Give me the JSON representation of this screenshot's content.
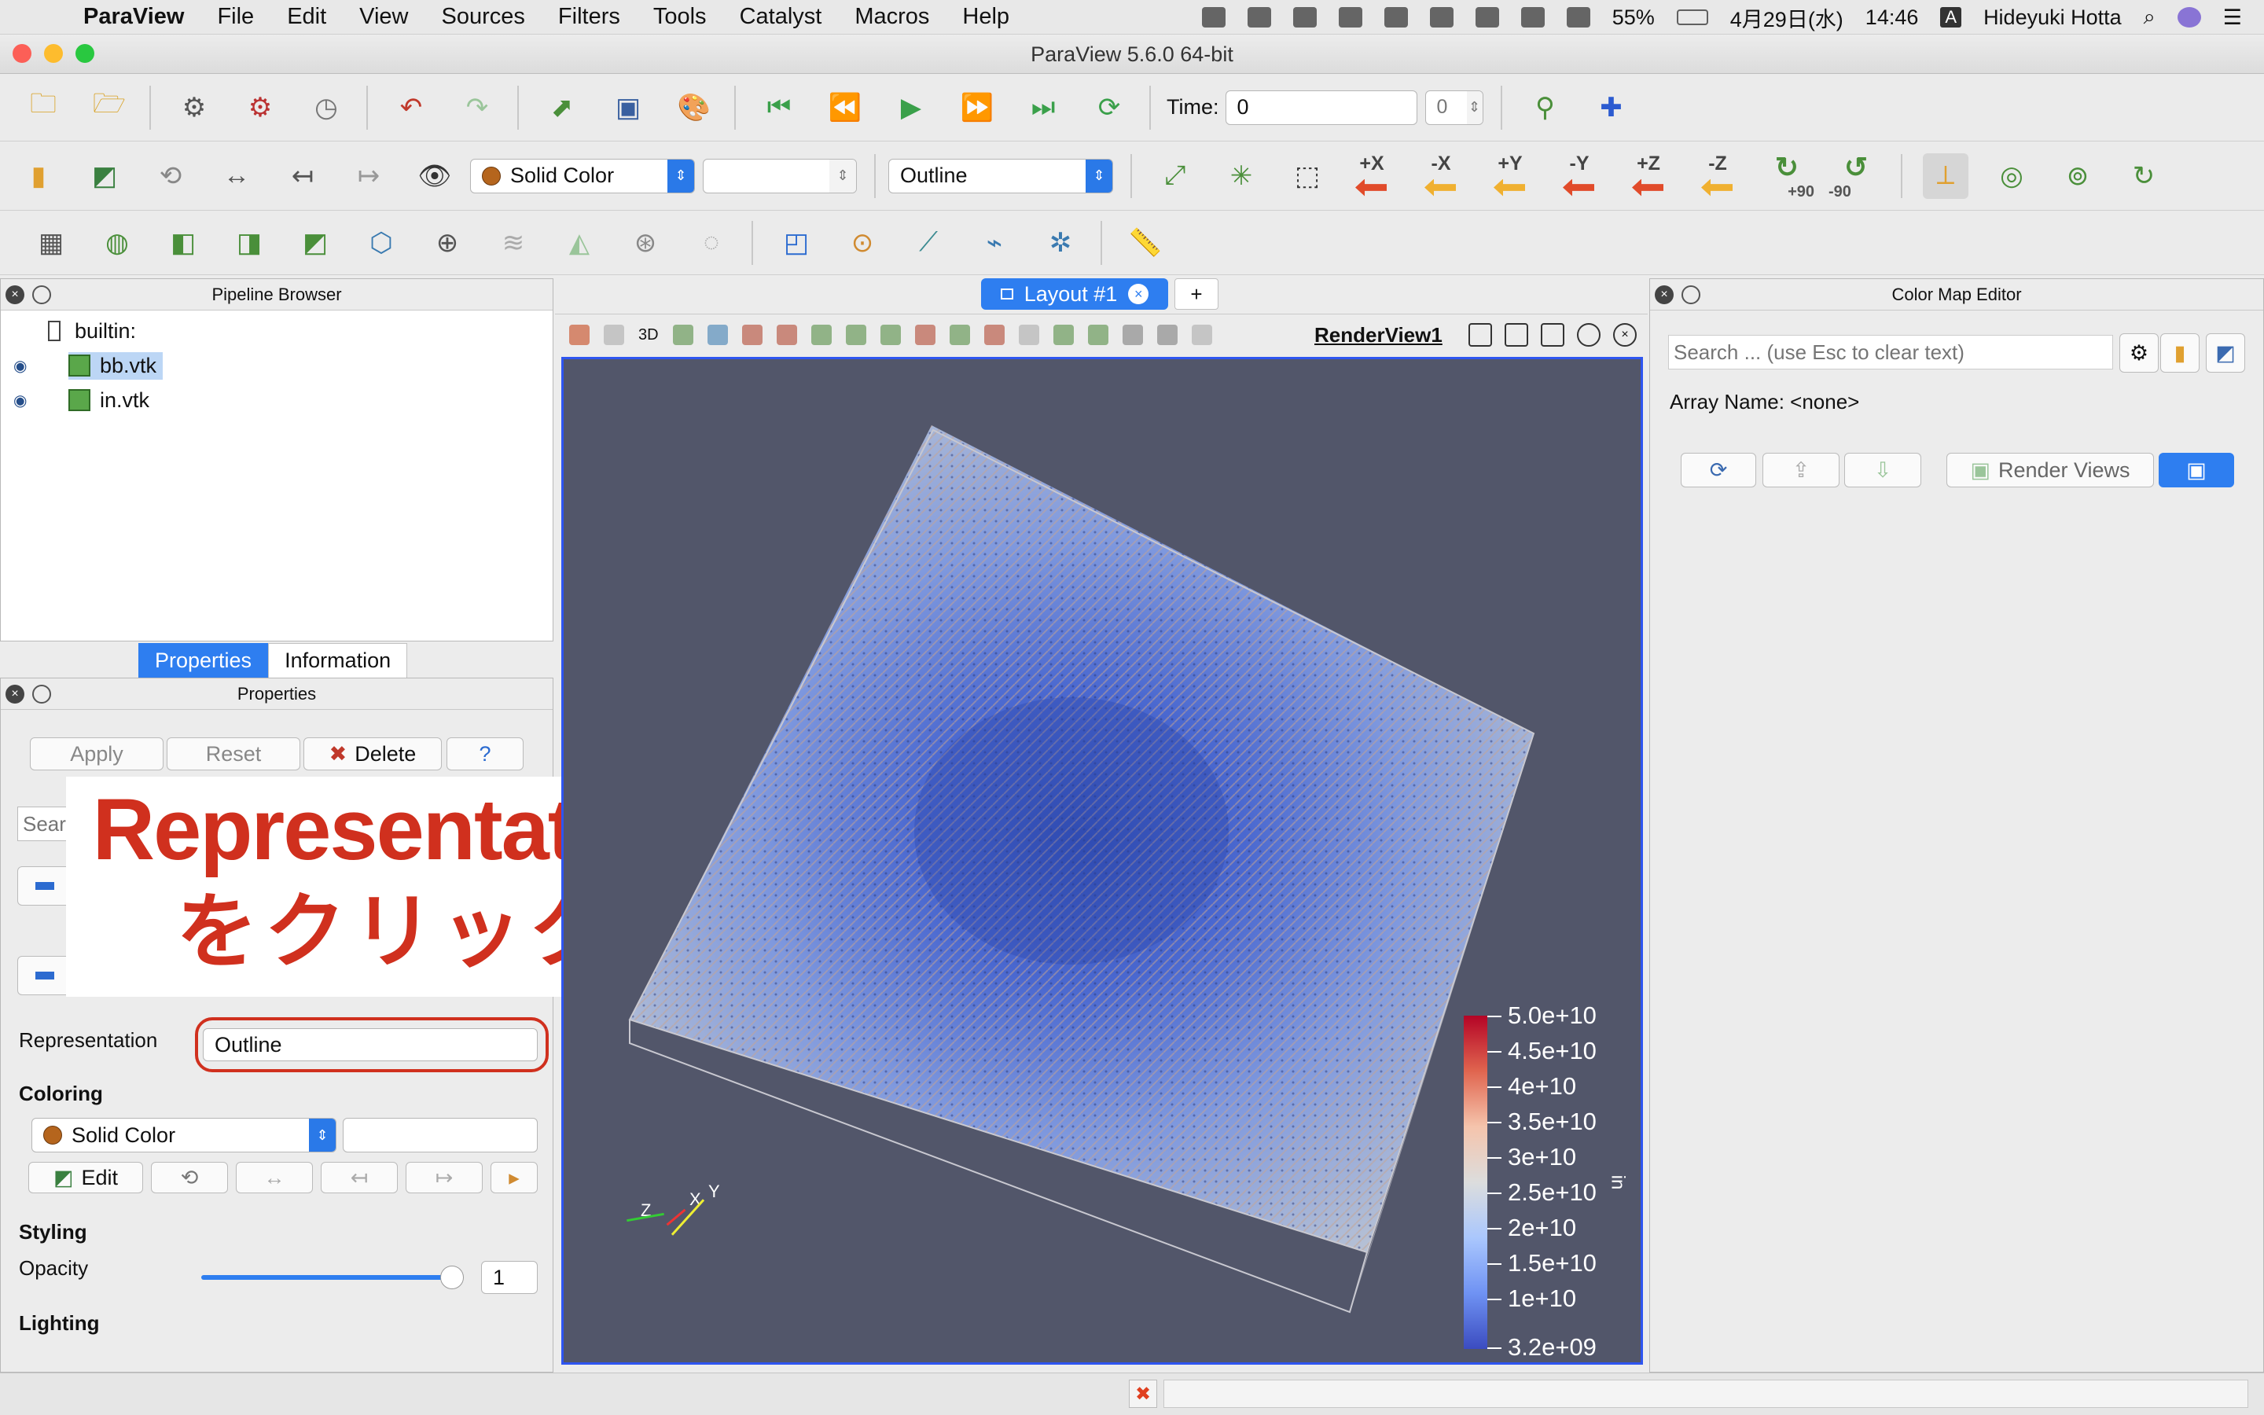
{
  "menubar": {
    "app": "ParaView",
    "items": [
      "File",
      "Edit",
      "View",
      "Sources",
      "Filters",
      "Tools",
      "Catalyst",
      "Macros",
      "Help"
    ],
    "battery": "55%",
    "date": "4月29日(水)",
    "time": "14:46",
    "input_mode": "A",
    "user": "Hideyuki Hotta"
  },
  "window": {
    "title": "ParaView 5.6.0 64-bit"
  },
  "toolbar1": {
    "time_label": "Time:",
    "time_value": "0",
    "time_step": "0"
  },
  "toolbar2": {
    "coloring_combo": "Solid Color",
    "representation_combo": "Outline",
    "axis_buttons": [
      "+X",
      "-X",
      "+Y",
      "-Y",
      "+Z",
      "-Z"
    ],
    "rot_plus": "+90",
    "rot_minus": "-90"
  },
  "pipeline": {
    "title": "Pipeline Browser",
    "root": "builtin:",
    "items": [
      "bb.vtk",
      "in.vtk"
    ]
  },
  "tabs": {
    "properties": "Properties",
    "information": "Information"
  },
  "properties": {
    "title": "Properties",
    "apply": "Apply",
    "reset": "Reset",
    "delete": "Delete",
    "help": "?",
    "search_placeholder": "Sear",
    "representation_label": "Representation",
    "representation_value": "Outline",
    "coloring_label": "Coloring",
    "coloring_value": "Solid Color",
    "edit": "Edit",
    "styling_label": "Styling",
    "opacity_label": "Opacity",
    "opacity_value": "1",
    "opacity_fraction": 1.0,
    "lighting_label": "Lighting"
  },
  "annotation": {
    "line1": "Representation",
    "line2": "をクリック"
  },
  "layout": {
    "tab": "Layout #1",
    "add": "+",
    "view_name": "RenderView1",
    "mode_3d": "3D"
  },
  "colorbar": {
    "labels": [
      "5.0e+10",
      "4.5e+10",
      "4e+10",
      "3.5e+10",
      "3e+10",
      "2.5e+10",
      "2e+10",
      "1.5e+10",
      "1e+10",
      "3.2e+09"
    ],
    "title": "in"
  },
  "axes": {
    "x": "X",
    "y": "Y",
    "z": "Z"
  },
  "colormap": {
    "title": "Color Map Editor",
    "search_placeholder": "Search ... (use Esc to clear text)",
    "array_name": "Array Name: <none>",
    "render_views": "Render Views"
  },
  "colors": {
    "accent": "#2e7ef0",
    "annotation": "#d0301e",
    "viewport_bg": "#52566a"
  }
}
